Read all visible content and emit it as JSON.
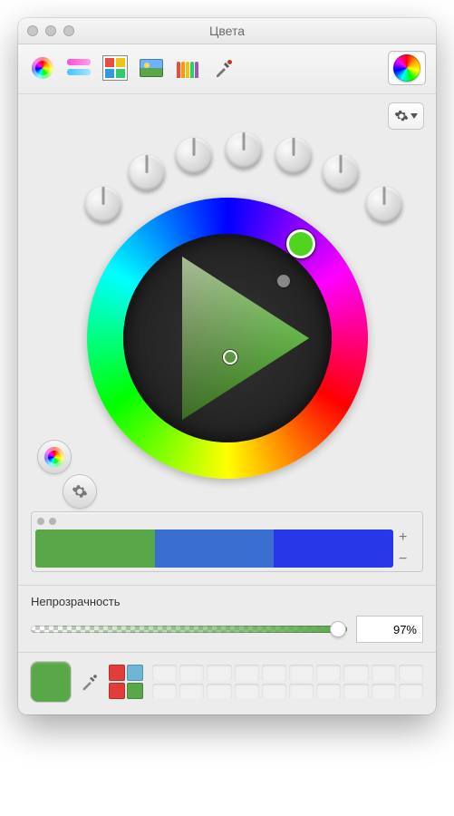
{
  "window": {
    "title": "Цвета"
  },
  "toolbar": {
    "modes": [
      {
        "name": "wheel-mode",
        "icon": "rainbow-wheel"
      },
      {
        "name": "sliders-mode",
        "icon": "sliders"
      },
      {
        "name": "palette-mode",
        "icon": "palette"
      },
      {
        "name": "image-mode",
        "icon": "image"
      },
      {
        "name": "pencils-mode",
        "icon": "pencils"
      },
      {
        "name": "eyedropper-mode",
        "icon": "eyedropper"
      },
      {
        "name": "advanced-wheel-mode",
        "icon": "rainbow-wheel-big",
        "selected": true
      }
    ]
  },
  "knobs": {
    "count": 7
  },
  "current_hue_color": "#4fd520",
  "swatch_strip": {
    "colors": [
      "#5aa74a",
      "#3a6fcf",
      "#2638e8"
    ]
  },
  "opacity": {
    "label": "Непрозрачность",
    "value": "97%",
    "percent": 97
  },
  "current_color": "#5aa74a",
  "mini_swatches": [
    "#e43b3b",
    "#6fb6d6",
    "#e43b3b",
    "#5aa74a"
  ],
  "icons": {
    "gear": "gear-icon",
    "plus": "+",
    "minus": "−"
  }
}
